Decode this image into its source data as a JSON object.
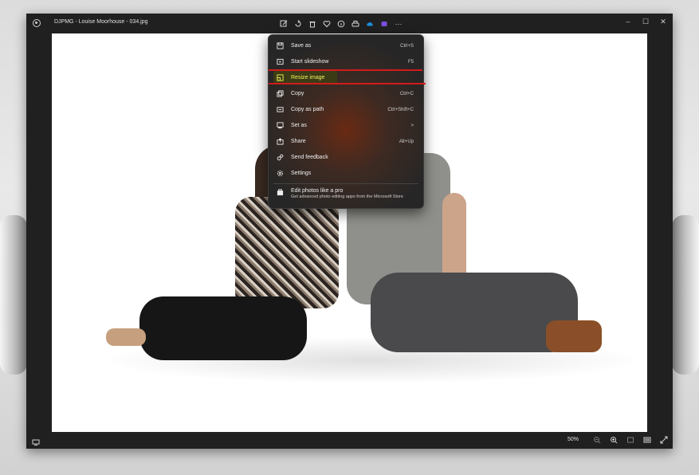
{
  "window": {
    "title": "DJPMG - Louise Moorhouse - 034.jpg",
    "app_icon": "photos-app-icon"
  },
  "toolbar": {
    "icons": [
      "edit-icon",
      "rotate-icon",
      "delete-icon",
      "favorite-heart-icon",
      "info-icon",
      "print-icon",
      "onedrive-cloud-icon",
      "clipchamp-icon",
      "more-icon"
    ]
  },
  "window_controls": {
    "minimize": "–",
    "maximize": "☐",
    "close": "✕"
  },
  "menu": {
    "items": [
      {
        "label": "Save as",
        "shortcut": "Ctrl+S",
        "icon": "save-icon"
      },
      {
        "label": "Start slideshow",
        "shortcut": "F5",
        "icon": "slideshow-icon"
      },
      {
        "label": "Resize image",
        "shortcut": "",
        "icon": "resize-icon",
        "highlighted": true
      },
      {
        "label": "Copy",
        "shortcut": "Ctrl+C",
        "icon": "copy-icon"
      },
      {
        "label": "Copy as path",
        "shortcut": "Ctrl+Shift+C",
        "icon": "copy-path-icon"
      },
      {
        "label": "Set as",
        "shortcut": ">",
        "icon": "set-as-icon"
      },
      {
        "label": "Share",
        "shortcut": "Alt+Up",
        "icon": "share-icon"
      },
      {
        "label": "Send feedback",
        "shortcut": "",
        "icon": "feedback-icon"
      },
      {
        "label": "Settings",
        "shortcut": "",
        "icon": "settings-gear-icon"
      }
    ],
    "promo": {
      "title": "Edit photos like a pro",
      "subtitle": "Get advanced photo editing apps from the Microsoft Store",
      "icon": "store-icon"
    },
    "highlight_color": "#f2f25a",
    "annotation_color": "#d21b1b"
  },
  "statusbar": {
    "zoom": "50%",
    "icons": [
      "filmstrip-icon",
      "zoom-out-icon",
      "zoom-in-icon",
      "fit-window-icon",
      "actual-size-icon",
      "fullscreen-icon"
    ]
  }
}
